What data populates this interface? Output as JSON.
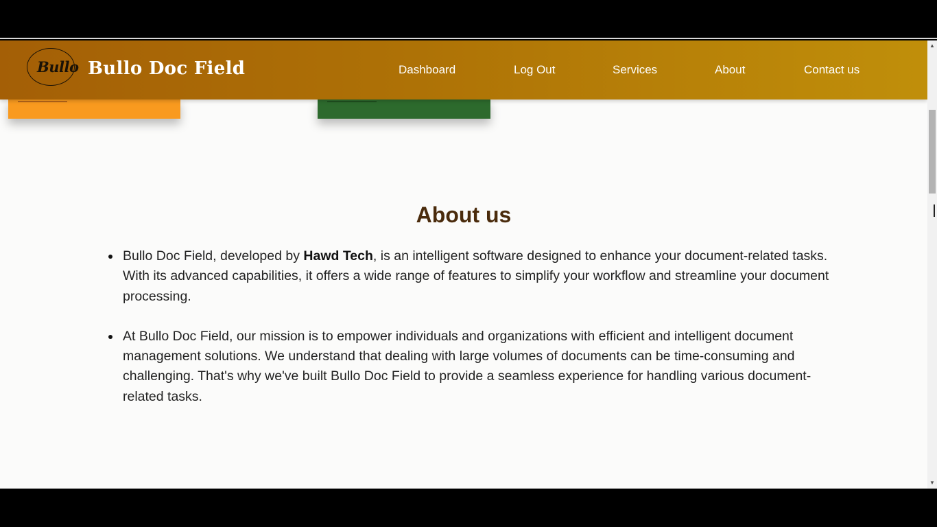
{
  "navbar": {
    "logo_text": "Bullo",
    "brand": "Bullo Doc Field",
    "items": [
      {
        "label": "Dashboard"
      },
      {
        "label": "Log Out"
      },
      {
        "label": "Services"
      },
      {
        "label": "About"
      },
      {
        "label": "Contact us"
      }
    ]
  },
  "about": {
    "title": "About us",
    "p1": {
      "before": "Bullo Doc Field, developed by ",
      "bold": "Hawd Tech",
      "after": ", is an intelligent software designed to enhance your document-related tasks. With its advanced capabilities, it offers a wide range of features to simplify your workflow and streamline your document processing."
    },
    "p2": "At Bullo Doc Field, our mission is to empower individuals and organizations with efficient and intelligent document management solutions. We understand that dealing with large volumes of documents can be time-consuming and challenging. That's why we've built Bullo Doc Field to provide a seamless experience for handling various document-related tasks."
  },
  "scrollbar": {
    "up_icon": "▲",
    "down_icon": "▼"
  },
  "colors": {
    "navbar_start": "#a45f06",
    "navbar_end": "#c08f0a",
    "title": "#4a2b0c",
    "card_orange": "#f99a1f",
    "card_green": "#2d6a2d"
  }
}
